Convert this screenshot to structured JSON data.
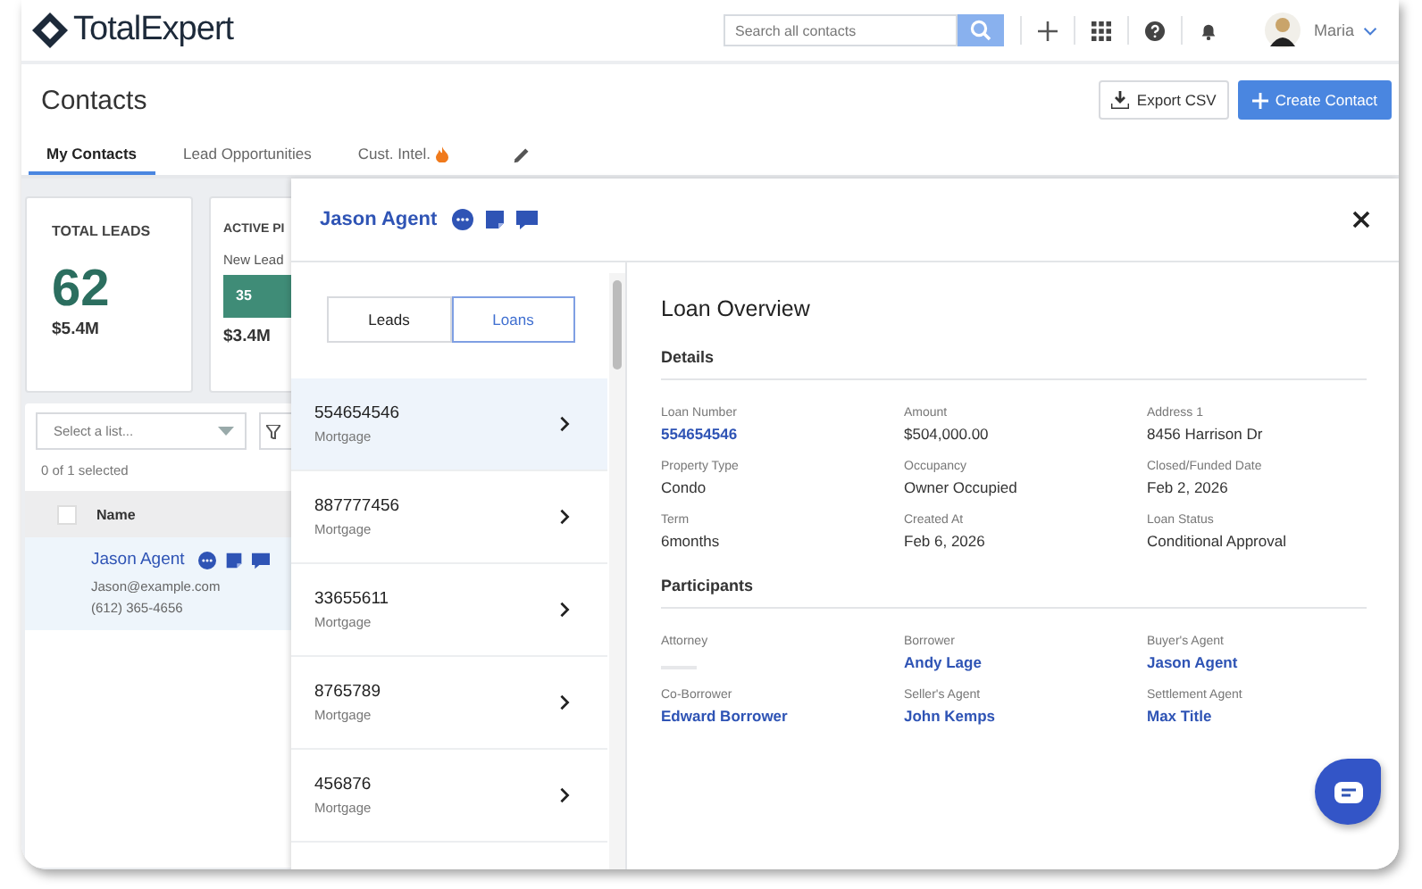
{
  "header": {
    "logo": "TotalExpert",
    "search": {
      "placeholder": "Search all contacts"
    },
    "user": "Maria"
  },
  "page": {
    "title": "Contacts",
    "export_button": "Export CSV",
    "create_button": "Create Contact"
  },
  "tabs": [
    {
      "label": "My Contacts",
      "selected": true
    },
    {
      "label": "Lead Opportunities",
      "selected": false
    },
    {
      "label": "Cust. Intel.",
      "selected": false,
      "flame": true
    }
  ],
  "stats": {
    "total": {
      "label": "TOTAL LEADS",
      "value": "62",
      "amount": "$5.4M"
    },
    "pipeline": {
      "label": "ACTIVE PI",
      "stage": "New Lead",
      "count": "35",
      "amount": "$3.4M"
    }
  },
  "contacts": {
    "list_select": {
      "placeholder": "Select a list..."
    },
    "selection": "0 of 1 selected",
    "columns": [
      "Name"
    ],
    "header_checked": false,
    "rows": [
      {
        "name": "Jason Agent",
        "email": "Jason@example.com",
        "phone": "(612) 365-4656",
        "selected": true
      }
    ]
  },
  "drawer": {
    "title": "Jason Agent",
    "toggle": [
      {
        "label": "Leads",
        "selected": false
      },
      {
        "label": "Loans",
        "selected": true
      }
    ],
    "loans": [
      {
        "number": "554654546",
        "type": "Mortgage",
        "selected": true
      },
      {
        "number": "887777456",
        "type": "Mortgage",
        "selected": false
      },
      {
        "number": "33655611",
        "type": "Mortgage",
        "selected": false
      },
      {
        "number": "8765789",
        "type": "Mortgage",
        "selected": false
      },
      {
        "number": "456876",
        "type": "Mortgage",
        "selected": false
      }
    ],
    "overview": {
      "title": "Loan Overview",
      "sections": [
        {
          "title": "Details",
          "fields": [
            {
              "label": "Loan Number",
              "value": "554654546",
              "kind": "link"
            },
            {
              "label": "Amount",
              "value": "$504,000.00",
              "kind": "text"
            },
            {
              "label": "Address 1",
              "value": "8456 Harrison Dr",
              "kind": "text"
            },
            {
              "label": "Property Type",
              "value": "Condo",
              "kind": "text"
            },
            {
              "label": "Occupancy",
              "value": "Owner Occupied",
              "kind": "text"
            },
            {
              "label": "Closed/Funded Date",
              "value": "Feb 2, 2026",
              "kind": "text"
            },
            {
              "label": "Term",
              "value": "6months",
              "kind": "text"
            },
            {
              "label": "Created At",
              "value": "Feb 6, 2026",
              "kind": "text"
            },
            {
              "label": "Loan Status",
              "value": "Conditional Approval",
              "kind": "text"
            }
          ]
        },
        {
          "title": "Participants",
          "fields": [
            {
              "label": "Attorney",
              "kind": "blank"
            },
            {
              "label": "Borrower",
              "value": "Andy Lage",
              "kind": "link"
            },
            {
              "label": "Buyer's Agent",
              "value": "Jason Agent",
              "kind": "link"
            },
            {
              "label": "Co-Borrower",
              "value": "Edward Borrower",
              "kind": "link"
            },
            {
              "label": "Seller's Agent",
              "value": "John Kemps",
              "kind": "link"
            },
            {
              "label": "Settlement Agent",
              "value": "Max Title",
              "kind": "link"
            }
          ]
        }
      ]
    }
  }
}
